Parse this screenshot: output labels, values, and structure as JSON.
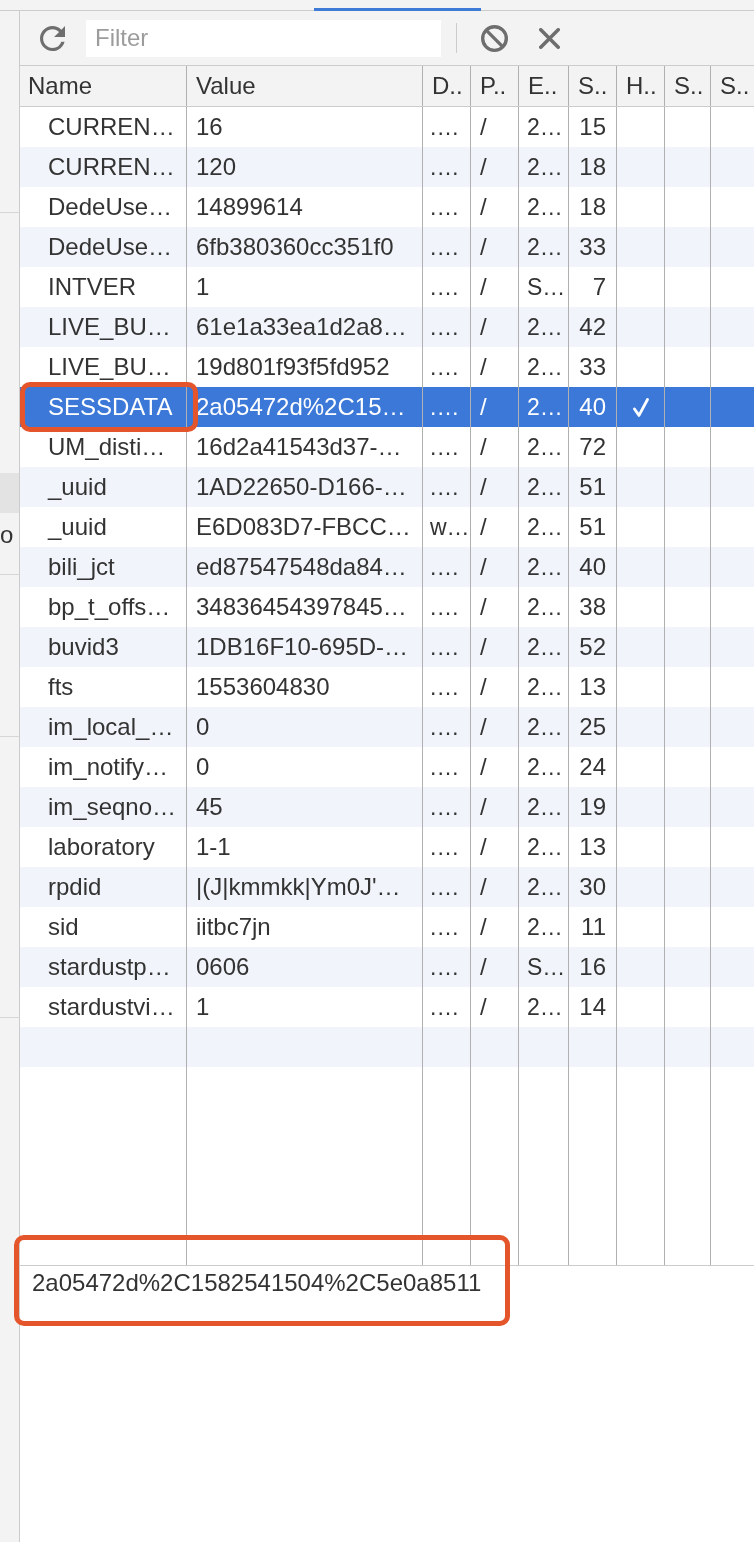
{
  "sidebar": {
    "items": [
      {
        "label": "o"
      }
    ]
  },
  "toolbar": {
    "filter": {
      "placeholder": "Filter"
    }
  },
  "table": {
    "columns": [
      "Name",
      "Value",
      "D..",
      "P..",
      "E..",
      "S..",
      "H..",
      "S..",
      "S.."
    ],
    "rows": [
      {
        "cells": [
          "CURREN…",
          "16",
          ".…",
          "/",
          "2…",
          "15"
        ],
        "column_7_checked": false,
        "selected": false,
        "annotated": false
      },
      {
        "cells": [
          "CURREN…",
          "120",
          ".…",
          "/",
          "2…",
          "18"
        ],
        "column_7_checked": false,
        "selected": false,
        "annotated": false
      },
      {
        "cells": [
          "DedeUse…",
          "14899614",
          ".…",
          "/",
          "2…",
          "18"
        ],
        "column_7_checked": false,
        "selected": false,
        "annotated": false
      },
      {
        "cells": [
          "DedeUse…",
          "6fb380360cc351f0",
          ".…",
          "/",
          "2…",
          "33"
        ],
        "column_7_checked": false,
        "selected": false,
        "annotated": false
      },
      {
        "cells": [
          "INTVER",
          "1",
          ".…",
          "/",
          "S…",
          "7"
        ],
        "column_7_checked": false,
        "selected": false,
        "annotated": false
      },
      {
        "cells": [
          "LIVE_BU…",
          "61e1a33ea1d2a8…",
          ".…",
          "/",
          "2…",
          "42"
        ],
        "column_7_checked": false,
        "selected": false,
        "annotated": false
      },
      {
        "cells": [
          "LIVE_BU…",
          "19d801f93f5fd952",
          ".…",
          "/",
          "2…",
          "33"
        ],
        "column_7_checked": false,
        "selected": false,
        "annotated": false
      },
      {
        "cells": [
          "SESSDATA",
          "2a05472d%2C15…",
          ".…",
          "/",
          "2…",
          "40"
        ],
        "column_7_checked": true,
        "selected": true,
        "annotated": true
      },
      {
        "cells": [
          "UM_disti…",
          "16d2a41543d37-…",
          ".…",
          "/",
          "2…",
          "72"
        ],
        "column_7_checked": false,
        "selected": false,
        "annotated": false
      },
      {
        "cells": [
          "_uuid",
          "1AD22650-D166-…",
          ".…",
          "/",
          "2…",
          "51"
        ],
        "column_7_checked": false,
        "selected": false,
        "annotated": false
      },
      {
        "cells": [
          "_uuid",
          "E6D083D7-FBCC…",
          "w…",
          "/",
          "2…",
          "51"
        ],
        "column_7_checked": false,
        "selected": false,
        "annotated": false
      },
      {
        "cells": [
          "bili_jct",
          "ed87547548da84…",
          ".…",
          "/",
          "2…",
          "40"
        ],
        "column_7_checked": false,
        "selected": false,
        "annotated": false
      },
      {
        "cells": [
          "bp_t_offs…",
          "34836454397845…",
          ".…",
          "/",
          "2…",
          "38"
        ],
        "column_7_checked": false,
        "selected": false,
        "annotated": false
      },
      {
        "cells": [
          "buvid3",
          "1DB16F10-695D-…",
          ".…",
          "/",
          "2…",
          "52"
        ],
        "column_7_checked": false,
        "selected": false,
        "annotated": false
      },
      {
        "cells": [
          "fts",
          "1553604830",
          ".…",
          "/",
          "2…",
          "13"
        ],
        "column_7_checked": false,
        "selected": false,
        "annotated": false
      },
      {
        "cells": [
          "im_local_…",
          "0",
          ".…",
          "/",
          "2…",
          "25"
        ],
        "column_7_checked": false,
        "selected": false,
        "annotated": false
      },
      {
        "cells": [
          "im_notify…",
          "0",
          ".…",
          "/",
          "2…",
          "24"
        ],
        "column_7_checked": false,
        "selected": false,
        "annotated": false
      },
      {
        "cells": [
          "im_seqno…",
          "45",
          ".…",
          "/",
          "2…",
          "19"
        ],
        "column_7_checked": false,
        "selected": false,
        "annotated": false
      },
      {
        "cells": [
          "laboratory",
          "1-1",
          ".…",
          "/",
          "2…",
          "13"
        ],
        "column_7_checked": false,
        "selected": false,
        "annotated": false
      },
      {
        "cells": [
          "rpdid",
          "|(J|kmmkk|Ym0J'…",
          ".…",
          "/",
          "2…",
          "30"
        ],
        "column_7_checked": false,
        "selected": false,
        "annotated": false
      },
      {
        "cells": [
          "sid",
          "iitbc7jn",
          ".…",
          "/",
          "2…",
          "11"
        ],
        "column_7_checked": false,
        "selected": false,
        "annotated": false
      },
      {
        "cells": [
          "stardustp…",
          "0606",
          ".…",
          "/",
          "S…",
          "16"
        ],
        "column_7_checked": false,
        "selected": false,
        "annotated": false
      },
      {
        "cells": [
          "stardustvi…",
          "1",
          ".…",
          "/",
          "2…",
          "14"
        ],
        "column_7_checked": false,
        "selected": false,
        "annotated": false
      }
    ]
  },
  "preview": {
    "text": "2a05472d%2C1582541504%2C5e0a8511",
    "annotated": true
  }
}
